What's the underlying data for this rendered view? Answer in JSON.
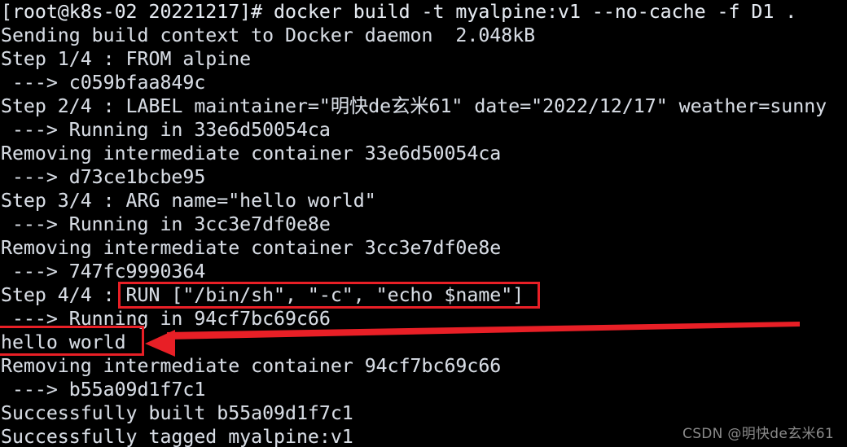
{
  "terminal": {
    "window_title": "Docker build terminal output",
    "background_color": "#000000",
    "foreground_color": "#d6dbe3",
    "prompt": "[root@k8s-02 20221217]#",
    "lines": [
      {
        "text": "[root@k8s-02 20221217]# docker build -t myalpine:v1 --no-cache -f D1 .",
        "kind": "command"
      },
      {
        "text": "Sending build context to Docker daemon  2.048kB",
        "kind": "output"
      },
      {
        "text": "Step 1/4 : FROM alpine",
        "kind": "output"
      },
      {
        "text": " ---> c059bfaa849c",
        "kind": "output"
      },
      {
        "text": "Step 2/4 : LABEL maintainer=\"明快de玄米61\" date=\"2022/12/17\" weather=sunny",
        "kind": "output"
      },
      {
        "text": " ---> Running in 33e6d50054ca",
        "kind": "output"
      },
      {
        "text": "Removing intermediate container 33e6d50054ca",
        "kind": "output"
      },
      {
        "text": " ---> d73ce1bcbe95",
        "kind": "output"
      },
      {
        "text": "Step 3/4 : ARG name=\"hello world\"",
        "kind": "output"
      },
      {
        "text": " ---> Running in 3cc3e7df0e8e",
        "kind": "output"
      },
      {
        "text": "Removing intermediate container 3cc3e7df0e8e",
        "kind": "output"
      },
      {
        "text": " ---> 747fc9990364",
        "kind": "output"
      },
      {
        "text": "Step 4/4 : RUN [\"/bin/sh\", \"-c\", \"echo $name\"]",
        "kind": "output"
      },
      {
        "text": " ---> Running in 94cf7bc69c66",
        "kind": "output"
      },
      {
        "text": "hello world",
        "kind": "output"
      },
      {
        "text": "Removing intermediate container 94cf7bc69c66",
        "kind": "output"
      },
      {
        "text": " ---> b55a09d1f7c1",
        "kind": "output"
      },
      {
        "text": "Successfully built b55a09d1f7c1",
        "kind": "output"
      },
      {
        "text": "Successfully tagged myalpine:v1",
        "kind": "output"
      }
    ]
  },
  "annotations": {
    "highlight_color": "#e81f26",
    "run_instruction_box": {
      "label": "RUN [\"/bin/sh\", \"-c\", \"echo $name\"]",
      "description": "red rectangle around the RUN instruction on the Step 4/4 line"
    },
    "output_box": {
      "label": "hello world",
      "description": "red rectangle around the build output line"
    },
    "arrow": {
      "description": "red arrow pointing left from the right edge to the hello world box"
    }
  },
  "watermark": {
    "text": "CSDN @明快de玄米61",
    "color": "#8a8a8a"
  }
}
